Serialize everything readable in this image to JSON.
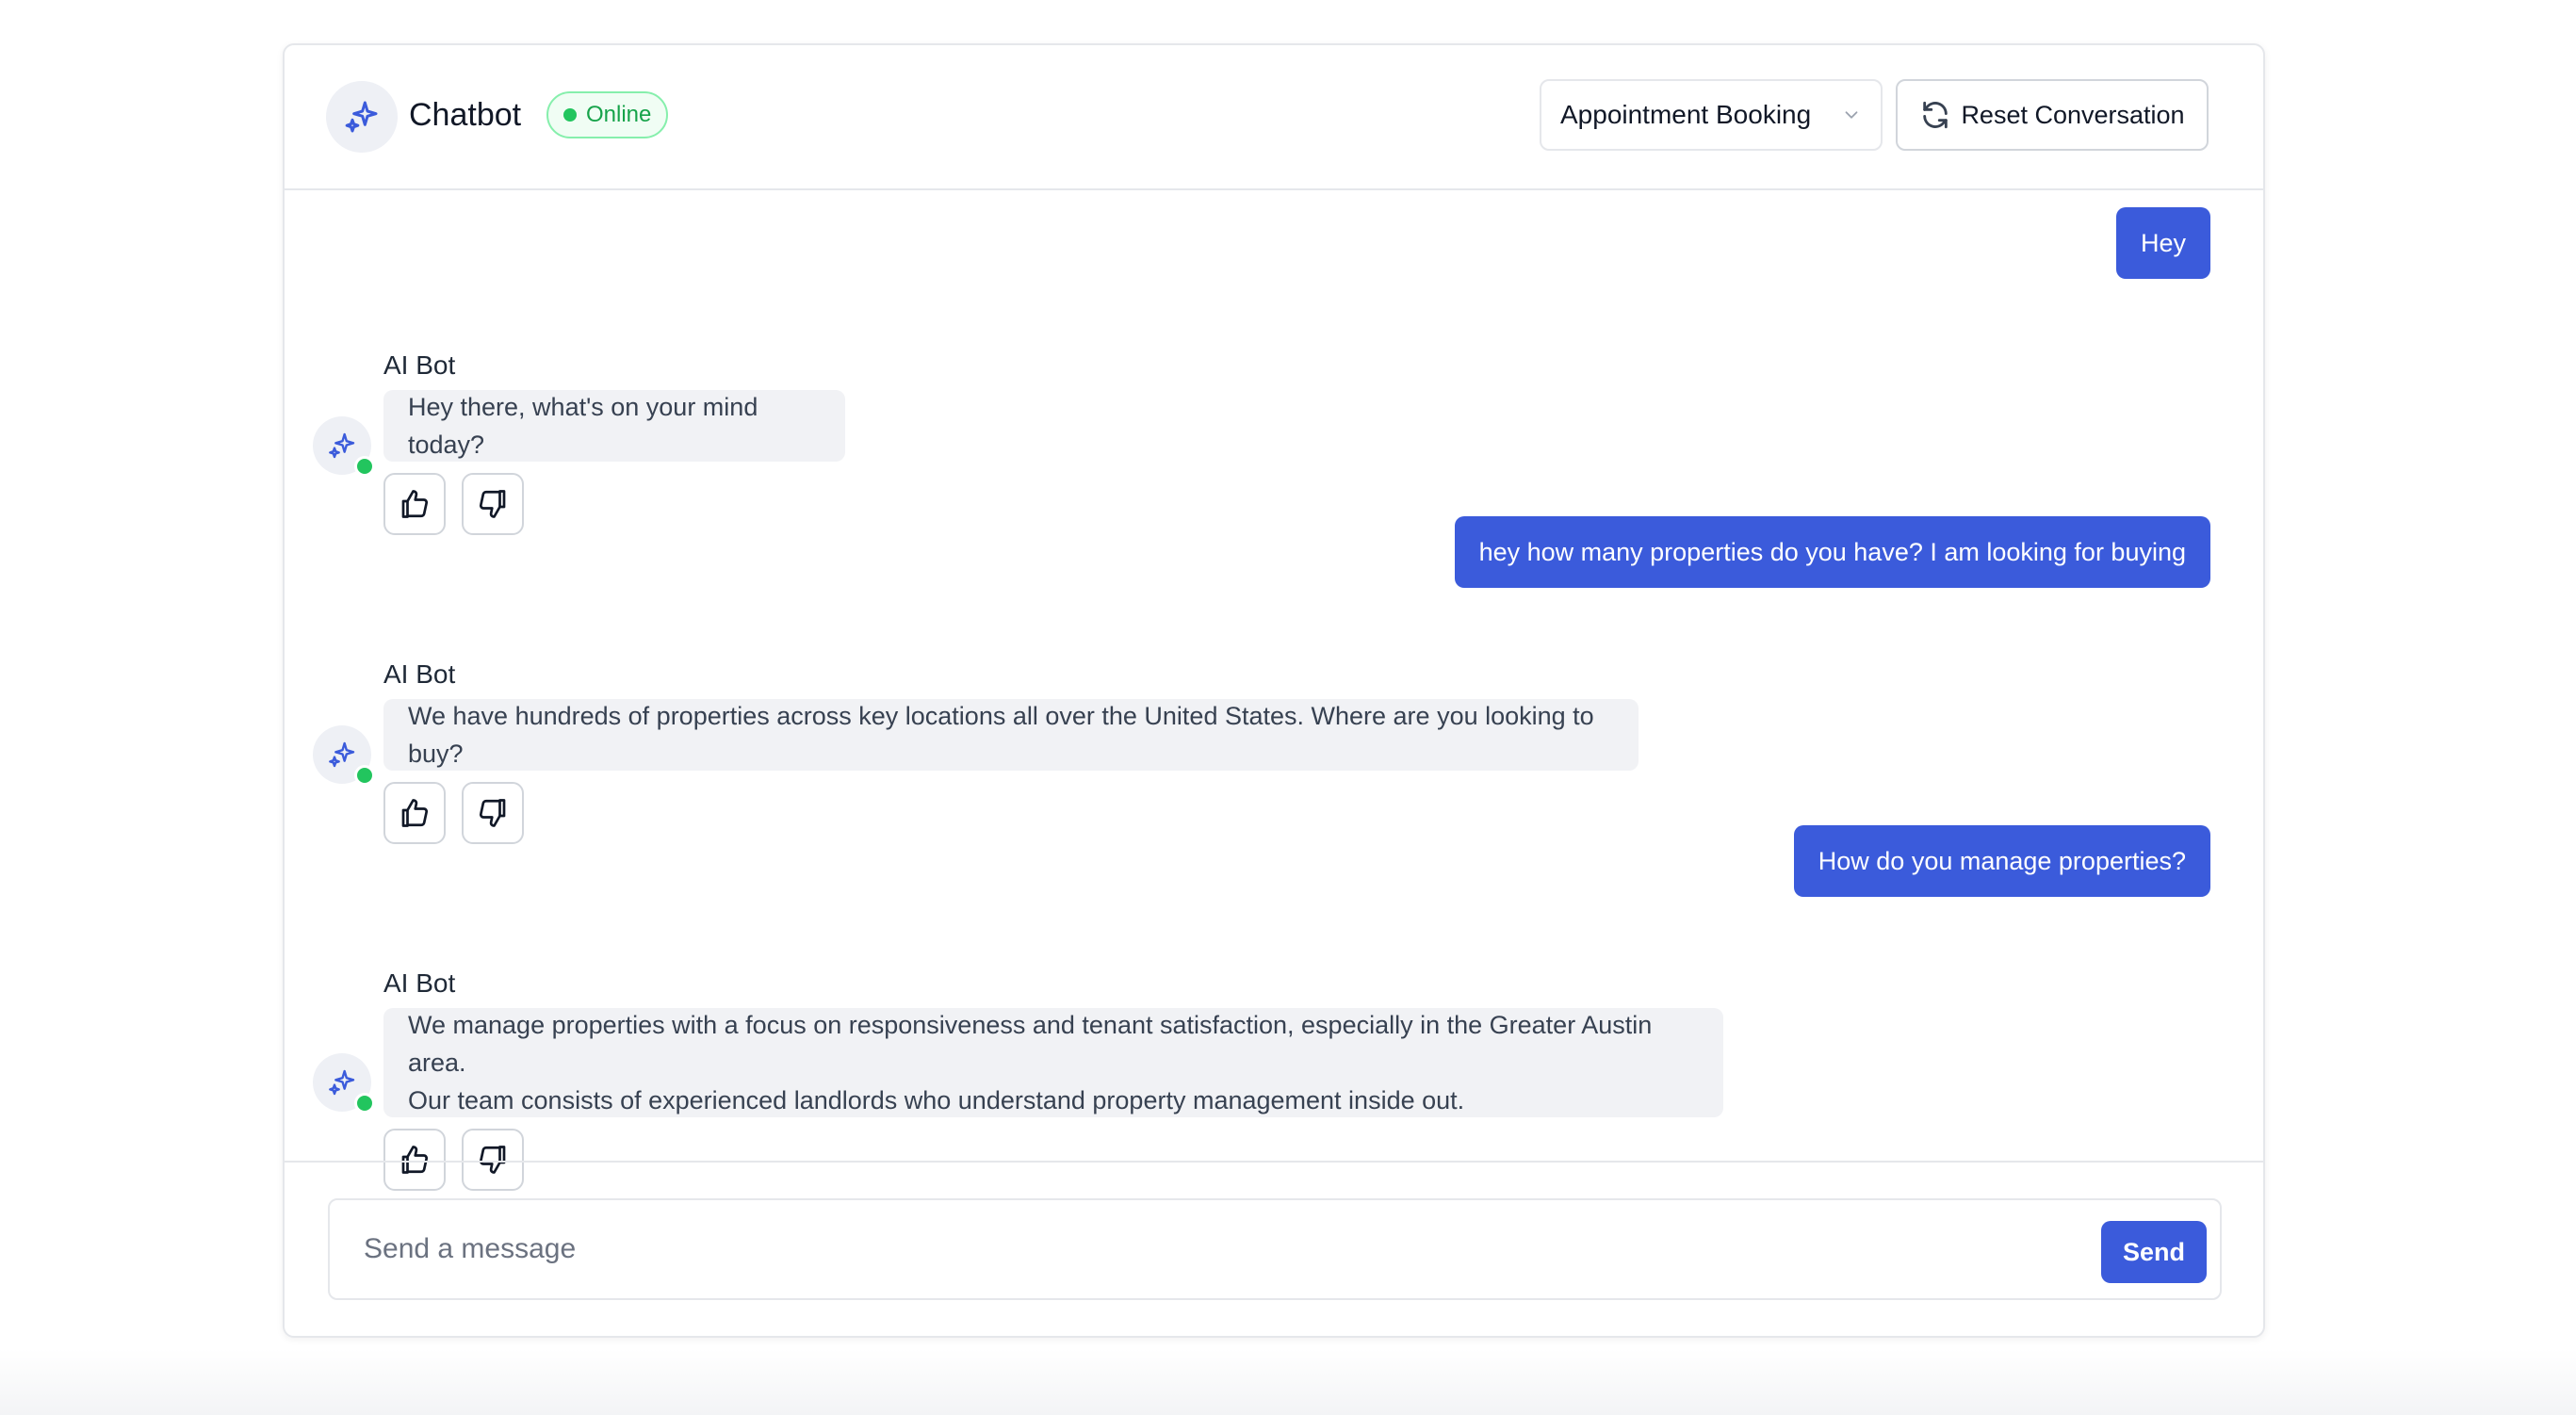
{
  "header": {
    "title": "Chatbot",
    "status": "Online",
    "mode_select": "Appointment Booking",
    "reset_label": "Reset Conversation"
  },
  "messages": [
    {
      "role": "user",
      "text": "Hey"
    },
    {
      "role": "bot",
      "author": "AI Bot",
      "lines": [
        "Hey there, what's on your mind today?"
      ]
    },
    {
      "role": "user",
      "text": "hey how many properties do you have? I am looking for buying"
    },
    {
      "role": "bot",
      "author": "AI Bot",
      "lines": [
        "We have hundreds of properties across key locations all over the United States. Where are you looking to buy?"
      ]
    },
    {
      "role": "user",
      "text": "How do you manage properties?"
    },
    {
      "role": "bot",
      "author": "AI Bot",
      "lines": [
        "We manage properties with a focus on responsiveness and tenant satisfaction, especially in the Greater Austin area.",
        "Our team consists of experienced landlords who understand property management inside out."
      ]
    }
  ],
  "composer": {
    "placeholder": "Send a message",
    "value": "",
    "send_label": "Send"
  },
  "colors": {
    "accent": "#3b5bdb",
    "online": "#22c55e",
    "bot_bubble": "#f1f2f5"
  },
  "icons": {
    "brand": "sparkles-icon",
    "reset": "refresh-icon",
    "select": "chevron-down-icon",
    "like": "thumbs-up-icon",
    "dislike": "thumbs-down-icon"
  }
}
